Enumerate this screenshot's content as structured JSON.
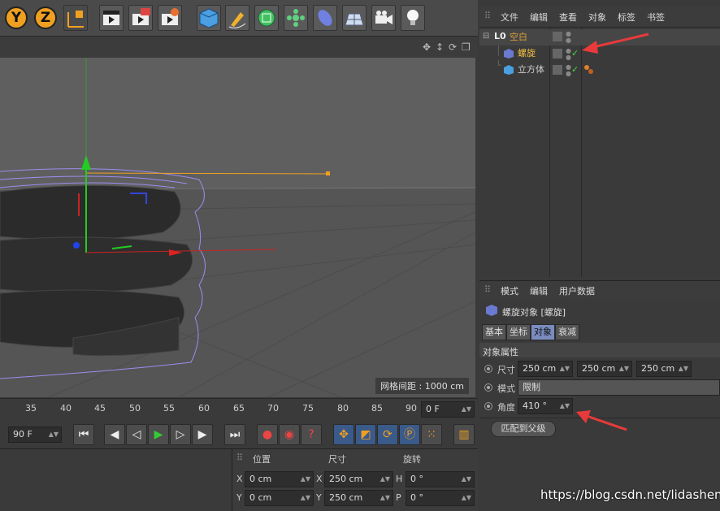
{
  "toolbar": {
    "axis_y": "Y",
    "axis_z": "Z"
  },
  "viewport": {
    "grid_label": "网格间距 : 1000 cm"
  },
  "timeline": {
    "ticks": [
      "35",
      "40",
      "45",
      "50",
      "55",
      "60",
      "65",
      "70",
      "75",
      "80",
      "85",
      "90"
    ],
    "current_frame": "0 F"
  },
  "transport": {
    "end_frame": "90 F"
  },
  "coords": {
    "headers": {
      "position": "位置",
      "size": "尺寸",
      "rotation": "旋转"
    },
    "rows": [
      {
        "axis_pos": "X",
        "pos": "0 cm",
        "axis_size": "X",
        "size": "250 cm",
        "axis_rot": "H",
        "rot": "0 °"
      },
      {
        "axis_pos": "Y",
        "pos": "0 cm",
        "axis_size": "Y",
        "size": "250 cm",
        "axis_rot": "P",
        "rot": "0 °"
      }
    ]
  },
  "object_manager": {
    "menu": [
      "文件",
      "编辑",
      "查看",
      "对象",
      "标签",
      "书签"
    ],
    "objects": [
      {
        "name": "空白",
        "color": "#d9a23a",
        "check": ""
      },
      {
        "name": "螺旋",
        "color": "#f0c040",
        "check": "✓"
      },
      {
        "name": "立方体",
        "color": "#cfcfcf",
        "check": "✓"
      }
    ]
  },
  "attributes": {
    "menu": [
      "模式",
      "编辑",
      "用户数据"
    ],
    "object_title": "螺旋对象 [螺旋]",
    "tabs": [
      "基本",
      "坐标",
      "对象",
      "衰减"
    ],
    "active_tab": "对象",
    "section": "对象属性",
    "size_label": "尺寸",
    "size_values": [
      "250 cm",
      "250 cm",
      "250 cm"
    ],
    "mode_label": "模式",
    "mode_value": "限制",
    "angle_label": "角度",
    "angle_value": "410 °",
    "fit_button": "匹配到父级"
  },
  "watermark": "https://blog.csdn.net/lidashent",
  "colors": {
    "accent": "#f0a020",
    "annotation_red": "#e83a3a",
    "active_tab": "#7a8cbf"
  }
}
